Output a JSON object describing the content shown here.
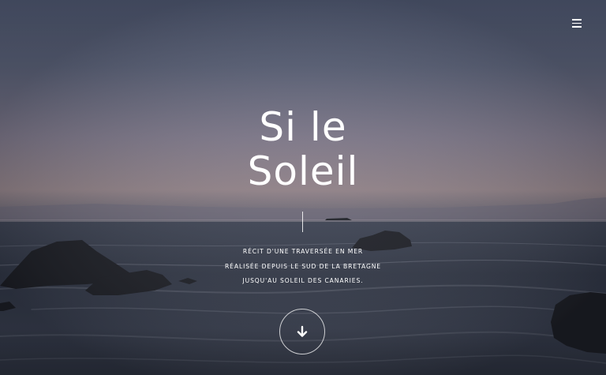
{
  "header": {
    "menu_icon": "hamburger-menu-icon"
  },
  "hero": {
    "title_line1": "Si le",
    "title_line2": "Soleil",
    "subtitle_line1": "RÉCIT D'UNE TRAVERSÉE EN MER",
    "subtitle_line2": "RÉALISÉE DEPUIS LE SUD DE LA BRETAGNE",
    "subtitle_line3": "JUSQU'AU SOLEIL DES CANARIES.",
    "scroll_icon": "arrow-down-icon"
  },
  "colors": {
    "text": "#ffffff",
    "sky_top": "#4f5870",
    "sky_horizon": "#8c7e84",
    "sea": "#2c3140"
  }
}
